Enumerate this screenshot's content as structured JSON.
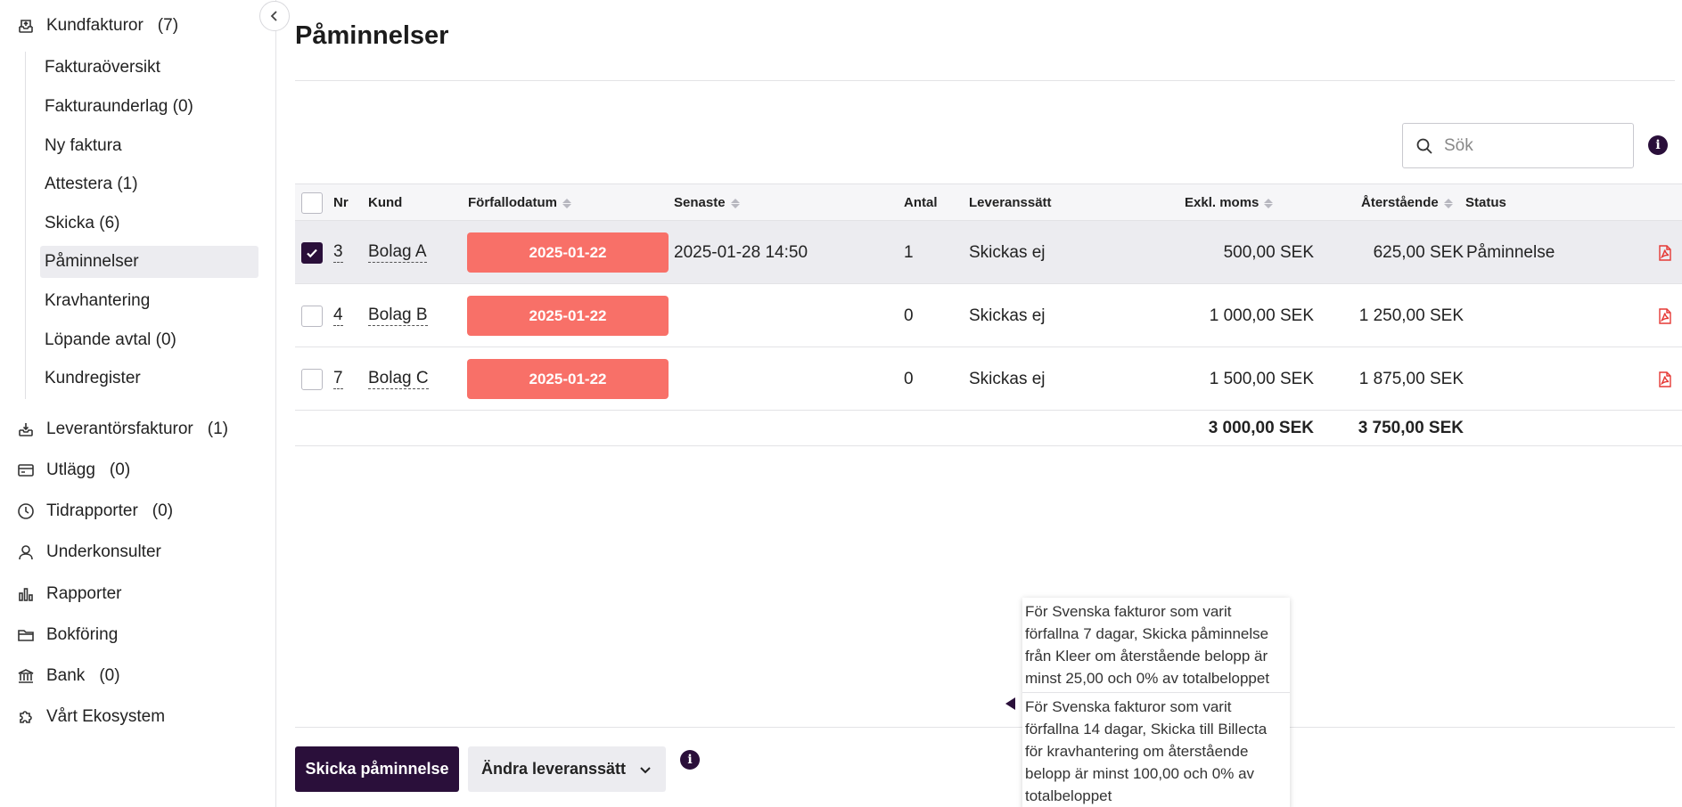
{
  "sidebar": {
    "kundfakturor": {
      "label": "Kundfakturor",
      "count": "(7)"
    },
    "sub_items": [
      {
        "label": "Fakturaöversikt"
      },
      {
        "label": "Fakturaunderlag (0)"
      },
      {
        "label": "Ny faktura"
      },
      {
        "label": "Attestera (1)"
      },
      {
        "label": "Skicka (6)"
      },
      {
        "label": "Påminnelser"
      },
      {
        "label": "Kravhantering"
      },
      {
        "label": "Löpande avtal (0)"
      },
      {
        "label": "Kundregister"
      }
    ],
    "active_sub_item": "Påminnelser",
    "items": [
      {
        "label": "Leverantörsfakturor",
        "count": "(1)",
        "icon": "inbox-download-icon"
      },
      {
        "label": "Utlägg",
        "count": "(0)",
        "icon": "credit-card-icon"
      },
      {
        "label": "Tidrapporter",
        "count": "(0)",
        "icon": "clock-icon"
      },
      {
        "label": "Underkonsulter",
        "count": "",
        "icon": "user-icon"
      },
      {
        "label": "Rapporter",
        "count": "",
        "icon": "bar-chart-icon"
      },
      {
        "label": "Bokföring",
        "count": "",
        "icon": "folder-icon"
      },
      {
        "label": "Bank",
        "count": "(0)",
        "icon": "bank-icon"
      },
      {
        "label": "Vårt Ekosystem",
        "count": "",
        "icon": "puzzle-icon"
      }
    ]
  },
  "page": {
    "title": "Påminnelser",
    "search_placeholder": "Sök"
  },
  "table": {
    "headers": {
      "nr": "Nr",
      "kund": "Kund",
      "forfallodatum": "Förfallodatum",
      "senaste": "Senaste",
      "antal": "Antal",
      "leveranssatt": "Leveranssätt",
      "exkl_moms": "Exkl. moms",
      "aterstaende": "Återstående",
      "status": "Status"
    },
    "rows": [
      {
        "checked": true,
        "nr": "3",
        "kund": "Bolag A",
        "due": "2025-01-22",
        "senaste": "2025-01-28 14:50",
        "antal": "1",
        "leveranssatt": "Skickas ej",
        "exkl_moms": "500,00 SEK",
        "aterstaende": "625,00 SEK",
        "status": "Påminnelse"
      },
      {
        "checked": false,
        "nr": "4",
        "kund": "Bolag B",
        "due": "2025-01-22",
        "senaste": "",
        "antal": "0",
        "leveranssatt": "Skickas ej",
        "exkl_moms": "1 000,00 SEK",
        "aterstaende": "1 250,00 SEK",
        "status": ""
      },
      {
        "checked": false,
        "nr": "7",
        "kund": "Bolag C",
        "due": "2025-01-22",
        "senaste": "",
        "antal": "0",
        "leveranssatt": "Skickas ej",
        "exkl_moms": "1 500,00 SEK",
        "aterstaende": "1 875,00 SEK",
        "status": ""
      }
    ],
    "totals": {
      "exkl_moms": "3 000,00 SEK",
      "aterstaende": "3 750,00 SEK"
    }
  },
  "footer": {
    "send_button": "Skicka påminnelse",
    "change_button": "Ändra leveranssätt"
  },
  "tooltip": {
    "lines": [
      "För Svenska fakturor som varit förfallna 7 dagar, Skicka påminnelse från Kleer om återstående belopp är minst 25,00 och 0% av totalbeloppet",
      "För Svenska fakturor som varit förfallna 14 dagar, Skicka till Billecta för kravhantering om återstående belopp är minst 100,00 och 0% av totalbeloppet"
    ]
  },
  "colors": {
    "primary": "#2a0f3a",
    "overdue": "#f87068",
    "pdf": "#e53935",
    "selected_row": "#ececf0"
  }
}
